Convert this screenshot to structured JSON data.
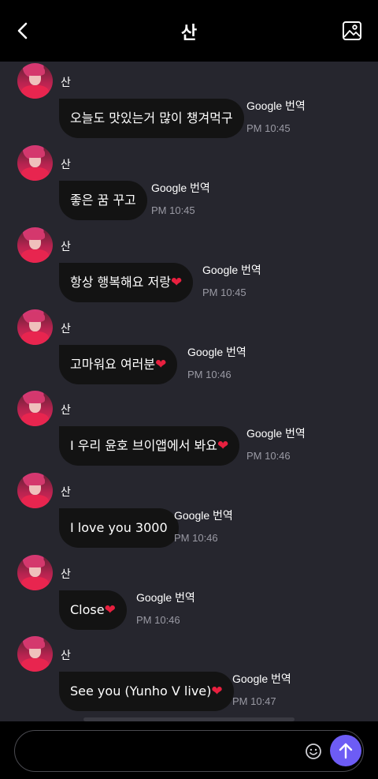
{
  "header": {
    "title": "산",
    "back_icon": "chevron-left-icon",
    "gallery_icon": "image-gallery-icon"
  },
  "colors": {
    "header_bg": "#000000",
    "chat_bg": "#26262e",
    "bubble_bg": "#131313",
    "heart": "#e8203f",
    "send_button": "#6d5cf5",
    "time_text": "#9a9aa4"
  },
  "messages": [
    {
      "sender": "산",
      "text": "오늘도 맛있는거 많이 챙겨먹구",
      "heart": "",
      "translate": "Google 번역",
      "time": "PM 10:45"
    },
    {
      "sender": "산",
      "text": "좋은 꿈 꾸고",
      "heart": "",
      "translate": "Google 번역",
      "time": "PM 10:45"
    },
    {
      "sender": "산",
      "text": "항상 행복해요 저랑",
      "heart": "❤",
      "translate": "Google 번역",
      "time": "PM 10:45"
    },
    {
      "sender": "산",
      "text": "고마워요 여러분",
      "heart": "❤",
      "translate": "Google 번역",
      "time": "PM 10:46"
    },
    {
      "sender": "산",
      "text": "I 우리 윤호 브이앱에서 봐요",
      "heart": "❤",
      "translate": "Google 번역",
      "time": "PM 10:46"
    },
    {
      "sender": "산",
      "text": "I love you 3000",
      "heart": "",
      "translate": "Google 번역",
      "time": "PM 10:46"
    },
    {
      "sender": "산",
      "text": "Close",
      "heart": "❤",
      "translate": "Google 번역",
      "time": "PM 10:46"
    },
    {
      "sender": "산",
      "text": "See you (Yunho V live)",
      "heart": "❤",
      "translate": "Google 번역",
      "time": "PM 10:47"
    }
  ],
  "input": {
    "value": "",
    "placeholder": "",
    "emoji_icon": "smiley-icon",
    "send_icon": "arrow-up-icon"
  }
}
